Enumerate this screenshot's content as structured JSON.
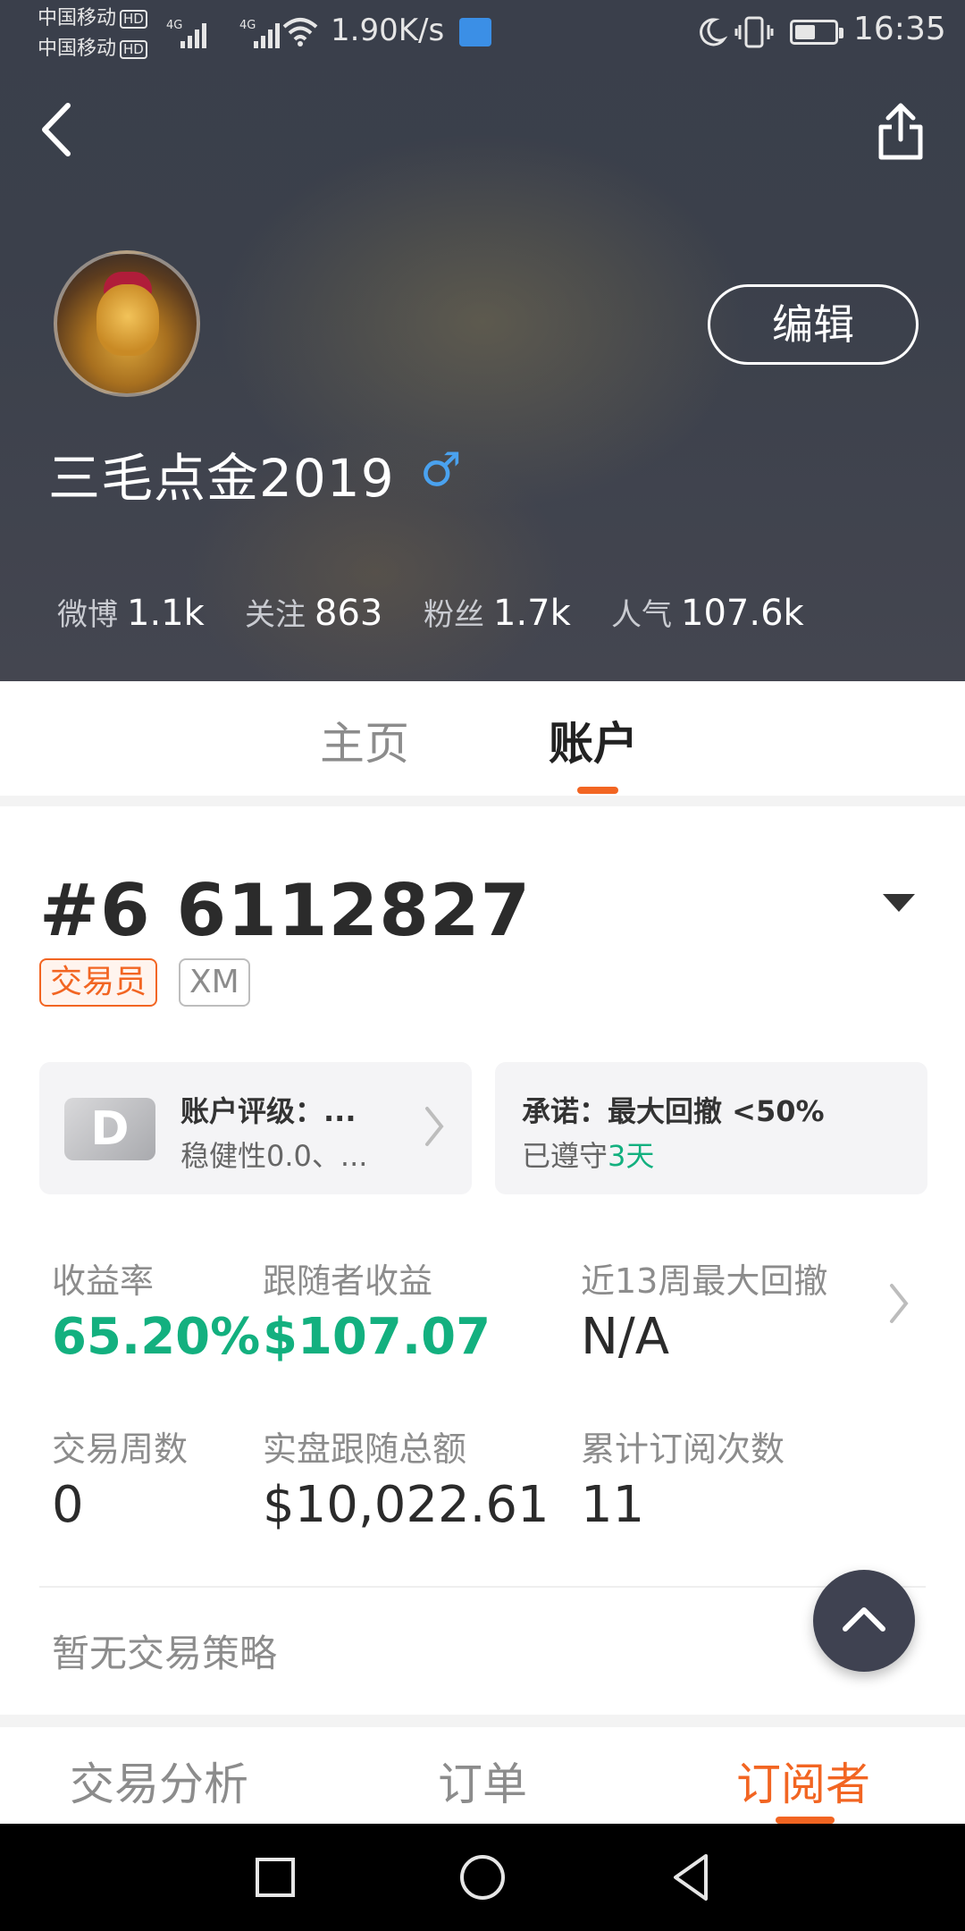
{
  "status_bar": {
    "carrier1": "中国移动",
    "carrier2": "中国移动",
    "hd": "HD",
    "net_type": "4G",
    "speed": "1.90K/s",
    "time": "16:35"
  },
  "header": {
    "username": "三毛点金2019",
    "gender_symbol": "♂",
    "edit_label": "编辑",
    "stats": [
      {
        "label": "微博",
        "value": "1.1k"
      },
      {
        "label": "关注",
        "value": "863"
      },
      {
        "label": "粉丝",
        "value": "1.7k"
      },
      {
        "label": "人气",
        "value": "107.6k"
      }
    ]
  },
  "tabs": {
    "home": "主页",
    "account": "账户",
    "active": "account"
  },
  "account": {
    "id": "#6 6112827",
    "badges": [
      "交易员",
      "XM"
    ],
    "rating_card": {
      "grade": "D",
      "title": "账户评级：...",
      "subtitle": "稳健性0.0、..."
    },
    "promise_card": {
      "title": "承诺：最大回撤 <50%",
      "subtitle_prefix": "已遵守",
      "subtitle_days": "3天"
    },
    "metrics": [
      {
        "label": "收益率",
        "value": "65.20%",
        "highlight": true
      },
      {
        "label": "跟随者收益",
        "value": "$107.07",
        "highlight": true
      },
      {
        "label": "近13周最大回撤",
        "value": "N/A",
        "highlight": false
      },
      {
        "label": "交易周数",
        "value": "0",
        "highlight": false
      },
      {
        "label": "实盘跟随总额",
        "value": "$10,022.61",
        "highlight": false
      },
      {
        "label": "累计订阅次数",
        "value": "11",
        "highlight": false
      }
    ],
    "no_strategy": "暂无交易策略"
  },
  "bottom_tabs": {
    "analysis": "交易分析",
    "orders": "订单",
    "subscribers": "订阅者",
    "active": "subscribers"
  },
  "colors": {
    "accent": "#f26522",
    "positive": "#13b07f",
    "gender": "#4aa2ef"
  }
}
